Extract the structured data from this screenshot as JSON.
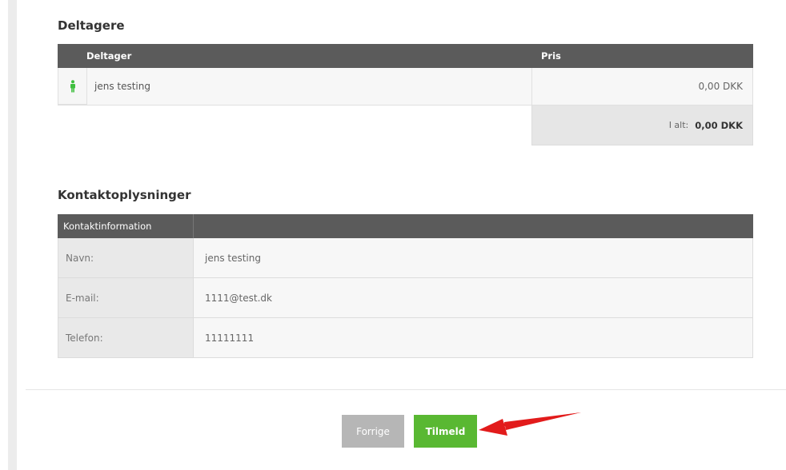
{
  "participants": {
    "title": "Deltagere",
    "columns": {
      "participant": "Deltager",
      "price": "Pris"
    },
    "rows": [
      {
        "name": "jens testing",
        "price": "0,00 DKK",
        "icon": "person-icon"
      }
    ],
    "total_label": "I alt:",
    "total_value": "0,00 DKK"
  },
  "contact": {
    "title": "Kontaktoplysninger",
    "header": "Kontaktinformation",
    "rows": [
      {
        "label": "Navn:",
        "value": "jens testing"
      },
      {
        "label": "E-mail:",
        "value": "1111@test.dk"
      },
      {
        "label": "Telefon:",
        "value": "11111111"
      }
    ]
  },
  "buttons": {
    "previous": "Forrige",
    "submit": "Tilmeld"
  },
  "colors": {
    "header_bg": "#5b5b5b",
    "submit_green": "#59b832",
    "previous_gray": "#b6b6b6",
    "person_icon": "#3fbf3f",
    "arrow_red": "#e21b1b"
  }
}
